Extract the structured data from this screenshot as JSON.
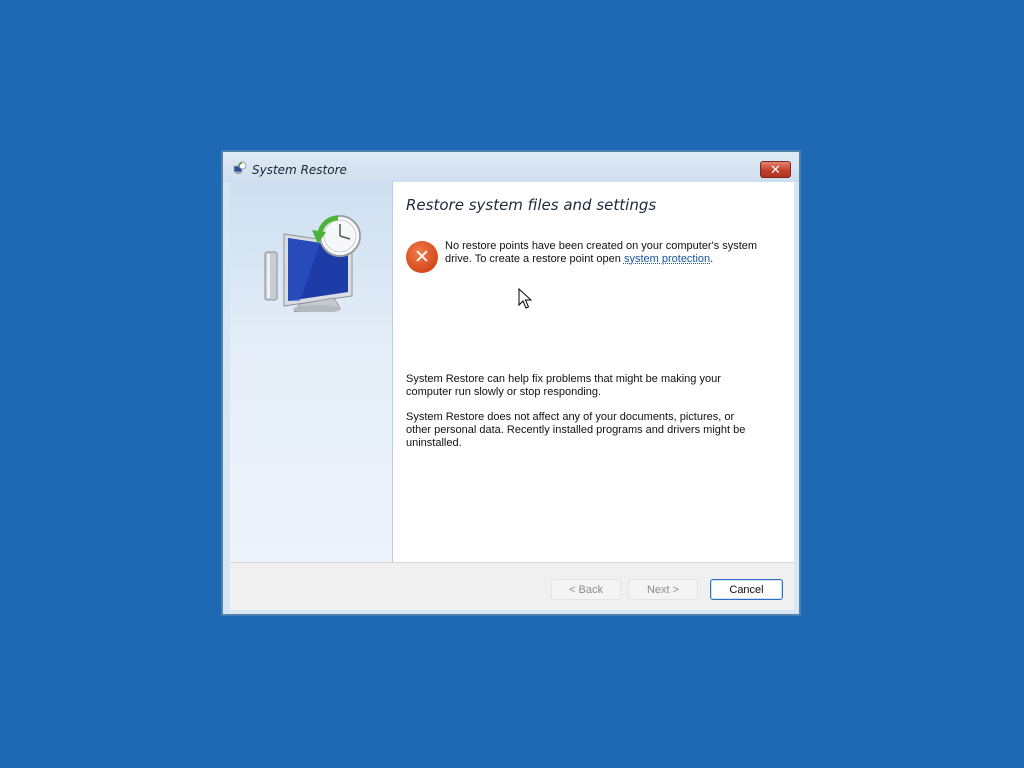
{
  "window": {
    "title": "System Restore",
    "title_icon": "system-restore-icon",
    "close_label": "✕"
  },
  "content": {
    "heading": "Restore system files and settings",
    "error_icon": "error-icon",
    "error_text_before": "No restore points have been created on your computer's system drive. To create a restore point open ",
    "error_link": "system protection",
    "error_text_after": ".",
    "paragraph1": "System Restore can help fix problems that might be making your computer run slowly or stop responding.",
    "paragraph2": "System Restore does not affect any of your documents, pictures, or other personal data. Recently installed programs and drivers might be uninstalled."
  },
  "footer": {
    "back_label": "< Back",
    "next_label": "Next >",
    "cancel_label": "Cancel",
    "back_enabled": false,
    "next_enabled": false
  },
  "colors": {
    "desktop": "#1f68b3",
    "error": "#d54a1c",
    "link": "#1a54a0",
    "focus_border": "#2a6cc4"
  }
}
